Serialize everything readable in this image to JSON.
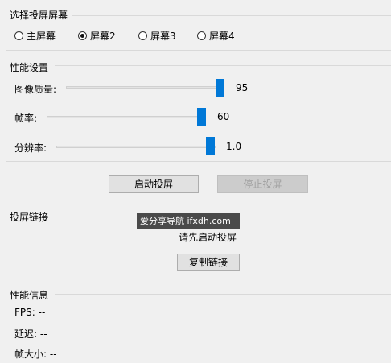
{
  "screen_group": {
    "title": "选择投屏屏幕",
    "options": [
      {
        "label": "主屏幕",
        "checked": false
      },
      {
        "label": "屏幕2",
        "checked": true
      },
      {
        "label": "屏幕3",
        "checked": false
      },
      {
        "label": "屏幕4",
        "checked": false
      }
    ]
  },
  "perf_settings": {
    "title": "性能设置",
    "quality": {
      "label": "图像质量:",
      "value": "95",
      "min": 0,
      "max": 100
    },
    "fps": {
      "label": "帧率:",
      "value": "60",
      "min": 0,
      "max": 60
    },
    "resolution": {
      "label": "分辨率:",
      "value": "1.0",
      "min": 0,
      "max": 1.0
    }
  },
  "actions": {
    "start_label": "启动投屏",
    "stop_label": "停止投屏"
  },
  "link_group": {
    "title": "投屏链接",
    "tooltip": "爱分享导航 ifxdh.com",
    "status": "请先启动投屏",
    "copy_label": "复制链接"
  },
  "perf_info": {
    "title": "性能信息",
    "fps": "FPS: --",
    "latency": "延迟: --",
    "frame_size": "帧大小: --"
  },
  "colors": {
    "accent": "#0078d7",
    "tooltip_bg": "#4a4a4a"
  }
}
